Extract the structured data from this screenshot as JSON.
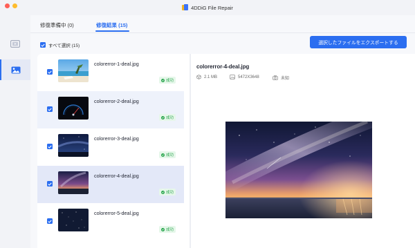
{
  "window": {
    "app_title": "4DDiG File Repair",
    "traffic_colors": [
      "#fe5f57",
      "#febc2e",
      "#28c840"
    ]
  },
  "sidebar": {
    "items": [
      {
        "icon": "video-icon",
        "active": false
      },
      {
        "icon": "image-icon",
        "active": true
      }
    ]
  },
  "tabs": [
    {
      "label": "修復準備中 (0)",
      "active": false
    },
    {
      "label": "修復結果 (15)",
      "active": true
    }
  ],
  "toolbar": {
    "select_all_label": "すべて選択 (15)",
    "export_label": "選択したファイルをエクスポートする"
  },
  "files": [
    {
      "name": "colorerror-1-deal.jpg",
      "status": "成功",
      "thumb": "beach"
    },
    {
      "name": "colorerror-2-deal.jpg",
      "status": "成功",
      "thumb": "dashboard"
    },
    {
      "name": "colorerror-3-deal.jpg",
      "status": "成功",
      "thumb": "galaxy"
    },
    {
      "name": "colorerror-4-deal.jpg",
      "status": "成功",
      "thumb": "milkyway"
    },
    {
      "name": "colorerror-5-deal.jpg",
      "status": "成功",
      "thumb": "stars"
    }
  ],
  "preview": {
    "title": "colorerror-4-deal.jpg",
    "size": "2.1 MB",
    "dimensions": "5472X3648",
    "camera": "未知"
  },
  "colors": {
    "accent": "#2b6ef0",
    "success": "#2aa64e",
    "success_bg": "#e6f7ea"
  }
}
